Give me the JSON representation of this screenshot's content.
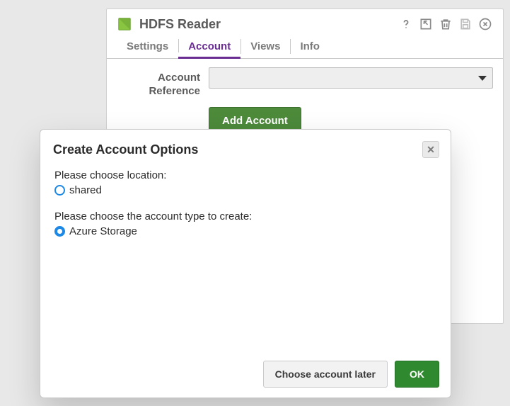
{
  "panel": {
    "title": "HDFS Reader",
    "tabs": [
      "Settings",
      "Account",
      "Views",
      "Info"
    ],
    "active_tab": 1,
    "field_label": "Account Reference",
    "add_account_label": "Add Account"
  },
  "dialog": {
    "title": "Create Account Options",
    "location_prompt": "Please choose location:",
    "location_options": [
      "shared"
    ],
    "location_selected": -1,
    "type_prompt": "Please choose the account type to create:",
    "type_options": [
      "Azure Storage"
    ],
    "type_selected": 0,
    "later_label": "Choose account later",
    "ok_label": "OK"
  }
}
